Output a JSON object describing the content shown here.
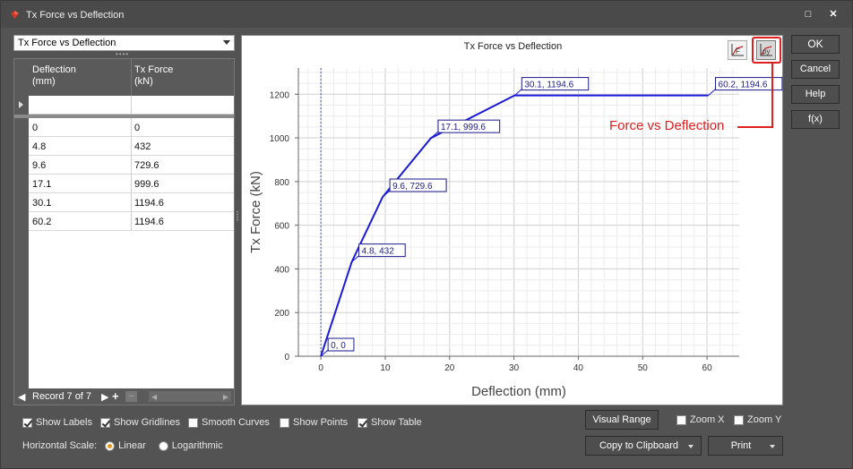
{
  "window": {
    "title": "Tx Force vs Deflection"
  },
  "selector": {
    "value": "Tx Force vs Deflection"
  },
  "table": {
    "headers": [
      {
        "line1": "Deflection",
        "line2": "(mm)"
      },
      {
        "line1": "Tx Force",
        "line2": "(kN)"
      }
    ],
    "rows": [
      [
        "0",
        "0"
      ],
      [
        "4.8",
        "432"
      ],
      [
        "9.6",
        "729.6"
      ],
      [
        "17.1",
        "999.6"
      ],
      [
        "30.1",
        "1194.6"
      ],
      [
        "60.2",
        "1194.6"
      ]
    ],
    "nav": {
      "record_label": "Record 7 of 7",
      "add": "+",
      "remove": "−"
    }
  },
  "chart_data": {
    "type": "line",
    "title": "Tx Force vs Deflection",
    "xlabel": "Deflection (mm)",
    "ylabel": "Tx Force (kN)",
    "x_ticks": [
      "0",
      "10",
      "20",
      "30",
      "40",
      "50",
      "60"
    ],
    "y_ticks": [
      "0",
      "200",
      "400",
      "600",
      "800",
      "1000",
      "1200"
    ],
    "xlim": [
      -3.5,
      65
    ],
    "ylim": [
      0,
      1320
    ],
    "grid": true,
    "series": [
      {
        "color": "#1a1ad8",
        "points": [
          {
            "x": 0,
            "y": 0,
            "label": "0, 0"
          },
          {
            "x": 4.8,
            "y": 432,
            "label": "4.8, 432"
          },
          {
            "x": 9.6,
            "y": 729.6,
            "label": "9.6, 729.6"
          },
          {
            "x": 17.1,
            "y": 999.6,
            "label": "17.1, 999.6"
          },
          {
            "x": 30.1,
            "y": 1194.6,
            "label": "30.1, 1194.6"
          },
          {
            "x": 60.2,
            "y": 1194.6,
            "label": "60.2, 1194.6"
          }
        ]
      }
    ]
  },
  "chart_buttons": [
    {
      "icon": "pf-chart-icon"
    },
    {
      "icon": "py-chart-icon"
    }
  ],
  "callout": {
    "text": "Force vs Deflection",
    "color": "#e02020"
  },
  "right_buttons": {
    "ok": "OK",
    "cancel": "Cancel",
    "help": "Help",
    "fx": "f(x)"
  },
  "options": {
    "show_labels": {
      "label": "Show Labels",
      "checked": true
    },
    "show_gridlines": {
      "label": "Show Gridlines",
      "checked": true
    },
    "smooth_curves": {
      "label": "Smooth Curves",
      "checked": false
    },
    "show_points": {
      "label": "Show Points",
      "checked": false
    },
    "show_table": {
      "label": "Show Table",
      "checked": true
    },
    "horizontal_scale_label": "Horizontal Scale:",
    "scale_linear": "Linear",
    "scale_log": "Logarithmic",
    "zoom_x": "Zoom X",
    "zoom_y": "Zoom Y"
  },
  "bottom_buttons": {
    "visual_range": "Visual Range",
    "copy": "Copy to Clipboard",
    "print": "Print"
  }
}
